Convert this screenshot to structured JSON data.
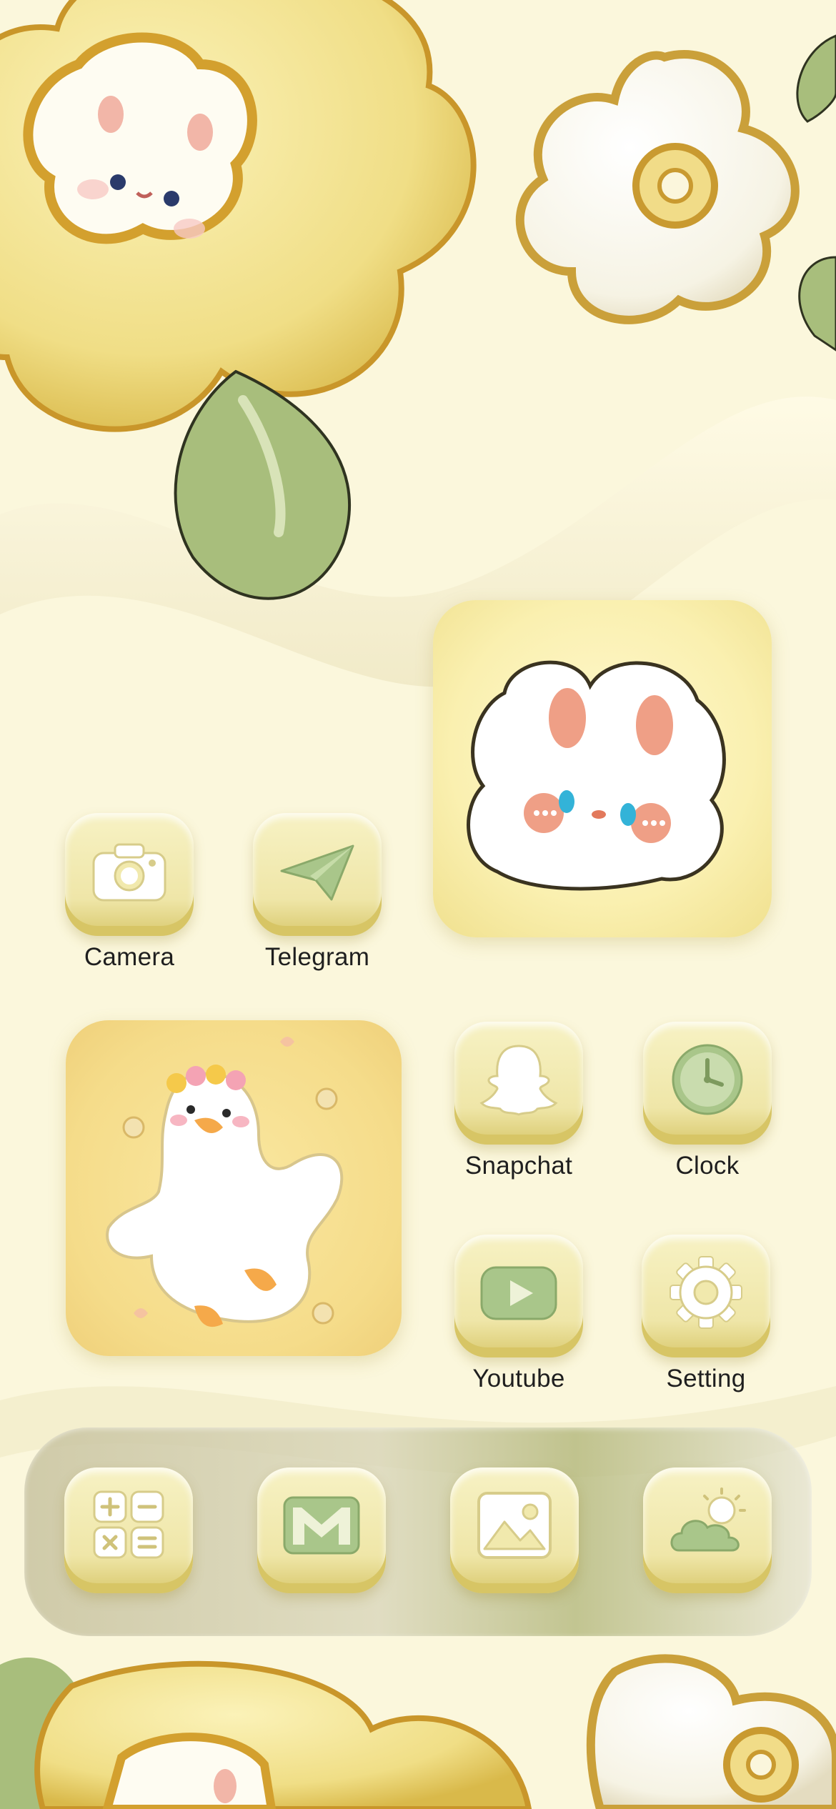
{
  "apps": {
    "camera": {
      "label": "Camera",
      "icon": "camera-icon"
    },
    "telegram": {
      "label": "Telegram",
      "icon": "paper-plane-icon"
    },
    "snapchat": {
      "label": "Snapchat",
      "icon": "ghost-icon"
    },
    "clock": {
      "label": "Clock",
      "icon": "clock-icon"
    },
    "youtube": {
      "label": "Youtube",
      "icon": "play-icon"
    },
    "setting": {
      "label": "Setting",
      "icon": "gear-icon"
    }
  },
  "dock": [
    {
      "icon": "calculator-icon"
    },
    {
      "icon": "mail-icon"
    },
    {
      "icon": "photos-icon"
    },
    {
      "icon": "weather-icon"
    }
  ],
  "widgets": {
    "bunny": "bunny-face-widget",
    "duck": "duck-widget"
  },
  "colors": {
    "background": "#fbf7dc",
    "icon_face": "#f1e9ad",
    "icon_glyph_green": "#a9c68a",
    "flower_gold": "#d4a83a",
    "leaf_green": "#a8be7c"
  }
}
